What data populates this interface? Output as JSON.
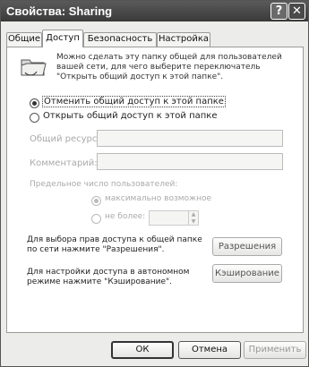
{
  "window": {
    "title": "Свойства: Sharing",
    "help_glyph": "?",
    "close_glyph": "✕"
  },
  "tabs": [
    {
      "label": "Общие"
    },
    {
      "label": "Доступ",
      "active": true
    },
    {
      "label": "Безопасность"
    },
    {
      "label": "Настройка"
    }
  ],
  "panel": {
    "icon": "shared-folder-icon",
    "description": "Можно сделать эту папку общей для пользователей вашей сети, для чего выберите переключатель \"Открыть общий доступ к этой папке\".",
    "radio_unshare": "Отменить общий доступ к этой папке",
    "radio_share": "Открыть общий доступ к этой папке",
    "share_name_label": "Общий ресурс:",
    "share_name_value": "",
    "comment_label": "Комментарий:",
    "comment_value": "",
    "user_limit_label": "Предельное число пользователей:",
    "max_allowed_label": "максимально возможное",
    "allow_label": "не более:",
    "permissions_note": "Для выбора прав доступа к общей папке по сети нажмите \"Разрешения\".",
    "permissions_button": "Разрешения",
    "caching_note": "Для настройки доступа в автономном режиме нажмите \"Кэширование\".",
    "caching_button": "Кэширование"
  },
  "footer": {
    "ok": "ОК",
    "cancel": "Отмена",
    "apply": "Применить"
  }
}
